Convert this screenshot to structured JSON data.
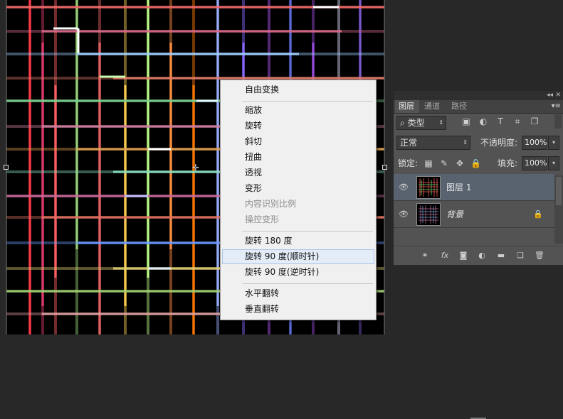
{
  "context_menu": {
    "items": [
      {
        "label": "自由变换",
        "enabled": true
      },
      {
        "label": "缩放",
        "enabled": true
      },
      {
        "label": "旋转",
        "enabled": true
      },
      {
        "label": "斜切",
        "enabled": true
      },
      {
        "label": "扭曲",
        "enabled": true
      },
      {
        "label": "透视",
        "enabled": true
      },
      {
        "label": "变形",
        "enabled": true
      },
      {
        "label": "内容识别比例",
        "enabled": false
      },
      {
        "label": "操控变形",
        "enabled": false
      },
      {
        "label": "旋转 180 度",
        "enabled": true
      },
      {
        "label": "旋转 90 度(顺时针)",
        "enabled": true,
        "hovered": true
      },
      {
        "label": "旋转 90 度(逆时针)",
        "enabled": true
      },
      {
        "label": "水平翻转",
        "enabled": true
      },
      {
        "label": "垂直翻转",
        "enabled": true
      }
    ]
  },
  "layers_panel": {
    "collapse_glyph": "◂◂",
    "close_glyph": "✕",
    "menu_glyph": "▾≡",
    "tabs": [
      {
        "label": "图层",
        "active": true
      },
      {
        "label": "通道",
        "active": false
      },
      {
        "label": "路径",
        "active": false
      }
    ],
    "filter": {
      "search_glyph": "⌕",
      "label": "类型",
      "arrow": "⇕"
    },
    "filter_icons": [
      "image-filter-icon",
      "adjustment-filter-icon",
      "text-filter-icon",
      "shape-filter-icon",
      "smart-object-filter-icon"
    ],
    "filter_glyphs": [
      "▣",
      "◐",
      "T",
      "⌗",
      "❐"
    ],
    "blend_mode": "正常",
    "blend_arrow": "⇕",
    "opacity_label": "不透明度:",
    "opacity_value": "100%",
    "lock_label": "锁定:",
    "lock_glyphs": [
      "▦",
      "✎",
      "✥",
      "🔒"
    ],
    "fill_label": "填充:",
    "fill_value": "100%",
    "dropdown_arrow": "▾",
    "layers": [
      {
        "name": "图层 1",
        "selected": true,
        "visible": true,
        "locked": false
      },
      {
        "name": "背景",
        "selected": false,
        "visible": true,
        "locked": true
      }
    ],
    "eye_glyph": "👁",
    "lock_glyph": "🔒",
    "bottom_glyphs": [
      "⚭",
      "fx",
      "◙",
      "◐",
      "▬",
      "❏",
      "🗑"
    ]
  },
  "colors": {
    "canvas_bg": "#000000",
    "workspace_bg": "#282828",
    "panel_bg": "#535353",
    "selected_layer": "#59636f",
    "menu_bg": "#f0f0f0"
  }
}
